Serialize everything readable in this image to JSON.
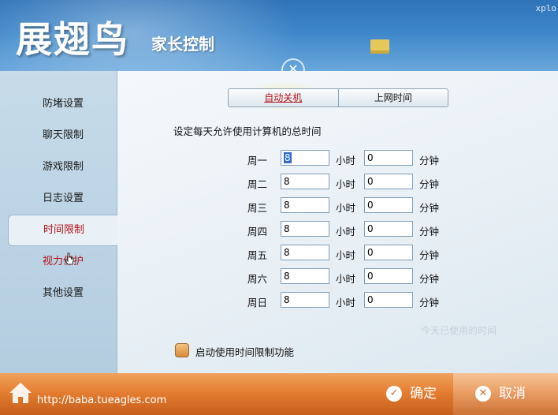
{
  "header": {
    "brand": "展翅鸟",
    "subtitle": "家长控制",
    "corner_text": "xplo"
  },
  "sidebar": {
    "items": [
      {
        "label": "防堵设置"
      },
      {
        "label": "聊天限制"
      },
      {
        "label": "游戏限制"
      },
      {
        "label": "日志设置"
      },
      {
        "label": "时间限制",
        "active": true
      },
      {
        "label": "视力保护"
      },
      {
        "label": "其他设置"
      }
    ]
  },
  "tabs": [
    {
      "label": "自动关机",
      "active": true
    },
    {
      "label": "上网时间"
    }
  ],
  "main": {
    "description": "设定每天允许使用计算机的总时间",
    "hour_unit": "小时",
    "minute_unit": "分钟",
    "days": [
      {
        "day": "周一",
        "hours": "8",
        "minutes": "0"
      },
      {
        "day": "周二",
        "hours": "8",
        "minutes": "0"
      },
      {
        "day": "周三",
        "hours": "8",
        "minutes": "0"
      },
      {
        "day": "周四",
        "hours": "8",
        "minutes": "0"
      },
      {
        "day": "周五",
        "hours": "8",
        "minutes": "0"
      },
      {
        "day": "周六",
        "hours": "8",
        "minutes": "0"
      },
      {
        "day": "周日",
        "hours": "8",
        "minutes": "0"
      }
    ],
    "used_today": "今天已使用的时间",
    "enable_label": "启动使用时间限制功能",
    "enable_checked": false
  },
  "footer": {
    "url": "http://baba.tueagles.com",
    "ok_label": "确定",
    "cancel_label": "取消"
  },
  "colors": {
    "header_blue": "#3d86c9",
    "accent_red": "#b2141b",
    "footer_orange": "#e47e32"
  }
}
